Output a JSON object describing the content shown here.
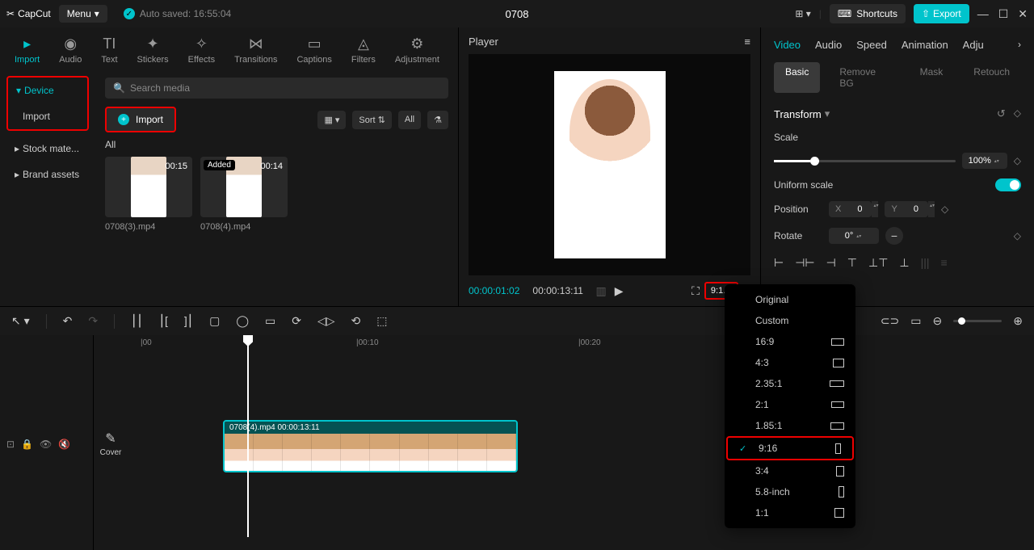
{
  "app": {
    "name": "CapCut",
    "menu": "Menu",
    "autosave": "Auto saved: 16:55:04",
    "project": "0708"
  },
  "topright": {
    "shortcuts": "Shortcuts",
    "export": "Export"
  },
  "tool_tabs": [
    {
      "label": "Import",
      "active": true
    },
    {
      "label": "Audio"
    },
    {
      "label": "Text"
    },
    {
      "label": "Stickers"
    },
    {
      "label": "Effects"
    },
    {
      "label": "Transitions"
    },
    {
      "label": "Captions"
    },
    {
      "label": "Filters"
    },
    {
      "label": "Adjustment"
    }
  ],
  "sidebar": {
    "device": "Device",
    "import": "Import",
    "stock": "Stock mate...",
    "brand": "Brand assets"
  },
  "media": {
    "search_placeholder": "Search media",
    "import_btn": "Import",
    "sort": "Sort",
    "all": "All",
    "filter_all": "All",
    "items": [
      {
        "duration": "00:15",
        "name": "0708(3).mp4",
        "added": ""
      },
      {
        "duration": "00:14",
        "name": "0708(4).mp4",
        "added": "Added"
      }
    ]
  },
  "player": {
    "title": "Player",
    "current": "00:00:01:02",
    "total": "00:00:13:11",
    "ratio_badge": "9:1…"
  },
  "props": {
    "tabs": [
      "Video",
      "Audio",
      "Speed",
      "Animation",
      "Adju"
    ],
    "sub_tabs": [
      "Basic",
      "Remove BG",
      "Mask",
      "Retouch"
    ],
    "transform": "Transform",
    "scale": "Scale",
    "scale_val": "100%",
    "uniform": "Uniform scale",
    "position": "Position",
    "pos_x": "0",
    "pos_y": "0",
    "rotate": "Rotate",
    "rotate_val": "0°"
  },
  "ruler": {
    "t0": "|00",
    "t10": "|00:10",
    "t20": "|00:20"
  },
  "clip": {
    "label": "0708(4).mp4   00:00:13:11"
  },
  "cover": "Cover",
  "ratios": [
    {
      "label": "Original"
    },
    {
      "label": "Custom"
    },
    {
      "label": "16:9",
      "shape": "shape-16-9"
    },
    {
      "label": "4:3",
      "shape": "shape-4-3"
    },
    {
      "label": "2.35:1",
      "shape": "shape-235-1"
    },
    {
      "label": "2:1",
      "shape": "shape-2-1"
    },
    {
      "label": "1.85:1",
      "shape": "shape-185-1"
    },
    {
      "label": "9:16",
      "shape": "shape-9-16",
      "selected": true
    },
    {
      "label": "3:4",
      "shape": "shape-3-4"
    },
    {
      "label": "5.8-inch",
      "shape": "shape-58"
    },
    {
      "label": "1:1",
      "shape": "shape-1-1"
    }
  ]
}
